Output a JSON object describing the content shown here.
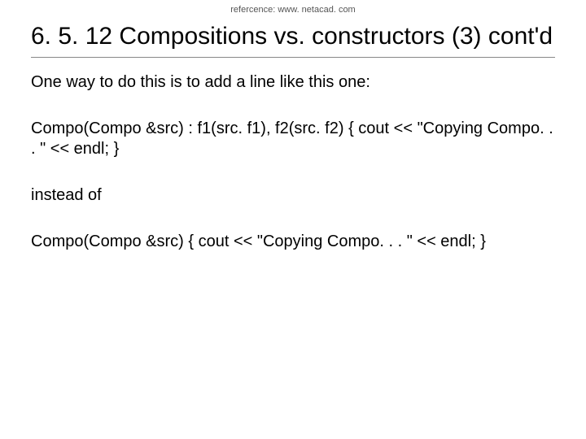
{
  "reference": "refercence: www. netacad. com",
  "title": "6. 5. 12 Compositions vs. constructors (3) cont'd",
  "paragraphs": {
    "p1": "One way to do this is to add a line like this one:",
    "p2": "Compo(Compo &src) : f1(src. f1), f2(src. f2) { cout << \"Copying Compo. . . \" << endl; }",
    "p3": "instead of",
    "p4": "Compo(Compo &src) { cout << \"Copying Compo. . . \" << endl; }"
  }
}
